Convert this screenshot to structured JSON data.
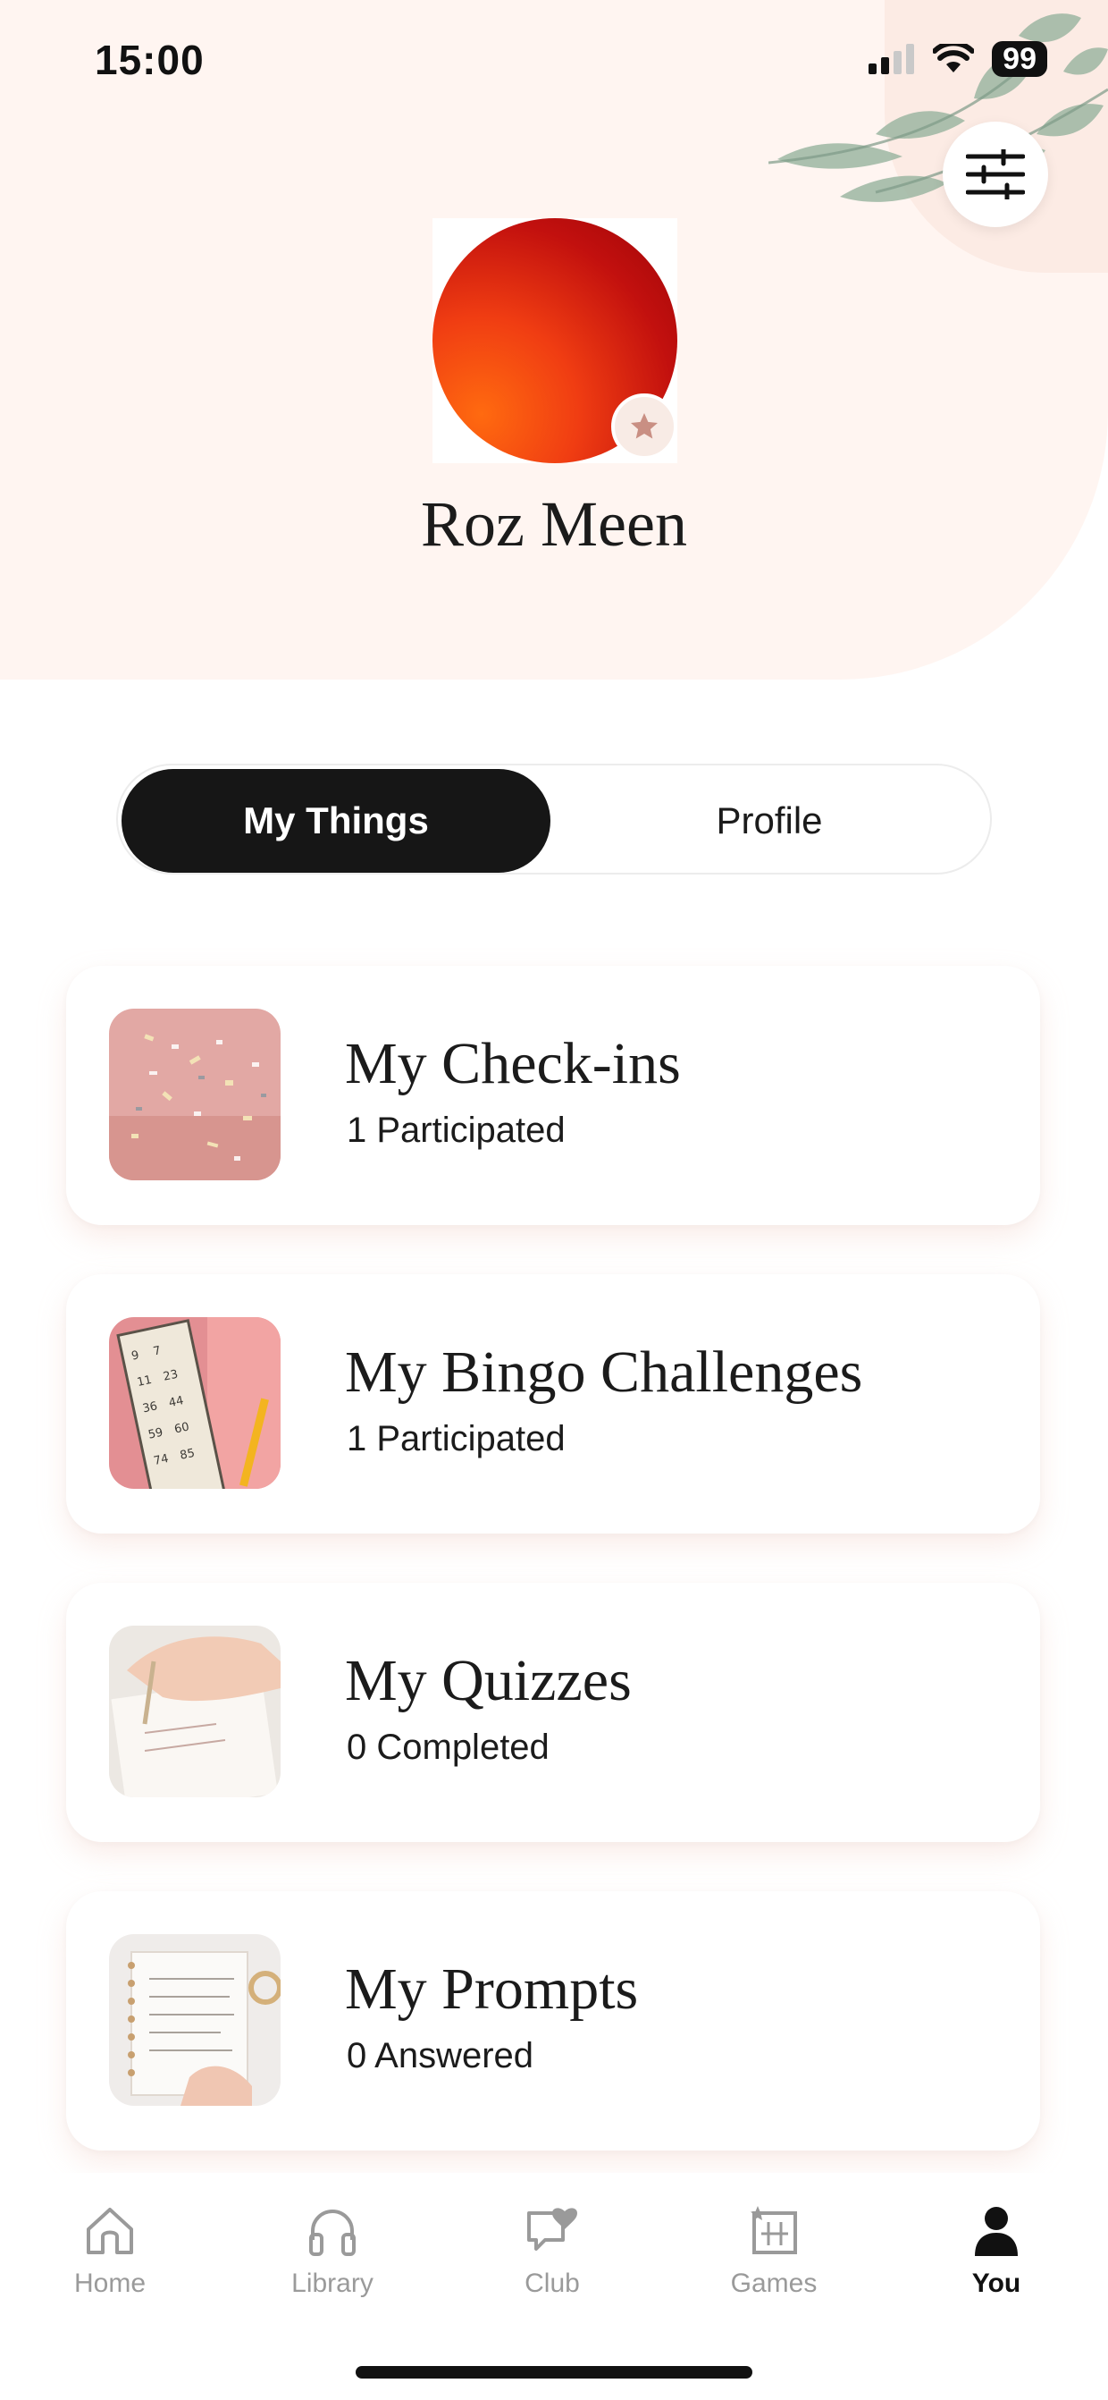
{
  "status": {
    "time": "15:00",
    "battery": "99"
  },
  "profile": {
    "name": "Roz Meen"
  },
  "tabs": [
    {
      "label": "My Things",
      "active": true
    },
    {
      "label": "Profile",
      "active": false
    }
  ],
  "cards": [
    {
      "title": "My Check-ins",
      "subtitle": "1 Participated",
      "image": "confetti"
    },
    {
      "title": "My Bingo Challenges",
      "subtitle": "1 Participated",
      "image": "bingo-card"
    },
    {
      "title": "My Quizzes",
      "subtitle": "0 Completed",
      "image": "writing-notebook"
    },
    {
      "title": "My Prompts",
      "subtitle": "0 Answered",
      "image": "journal-prompts"
    }
  ],
  "nav": [
    {
      "label": "Home",
      "icon": "home-icon"
    },
    {
      "label": "Library",
      "icon": "headphones-icon"
    },
    {
      "label": "Club",
      "icon": "chat-heart-icon"
    },
    {
      "label": "Games",
      "icon": "games-icon"
    },
    {
      "label": "You",
      "icon": "person-icon",
      "active": true
    }
  ],
  "colors": {
    "accent": "#161616",
    "hero_bg": "#fff5f1",
    "avatar": "#e0260f",
    "badge_star": "#c98f83"
  }
}
